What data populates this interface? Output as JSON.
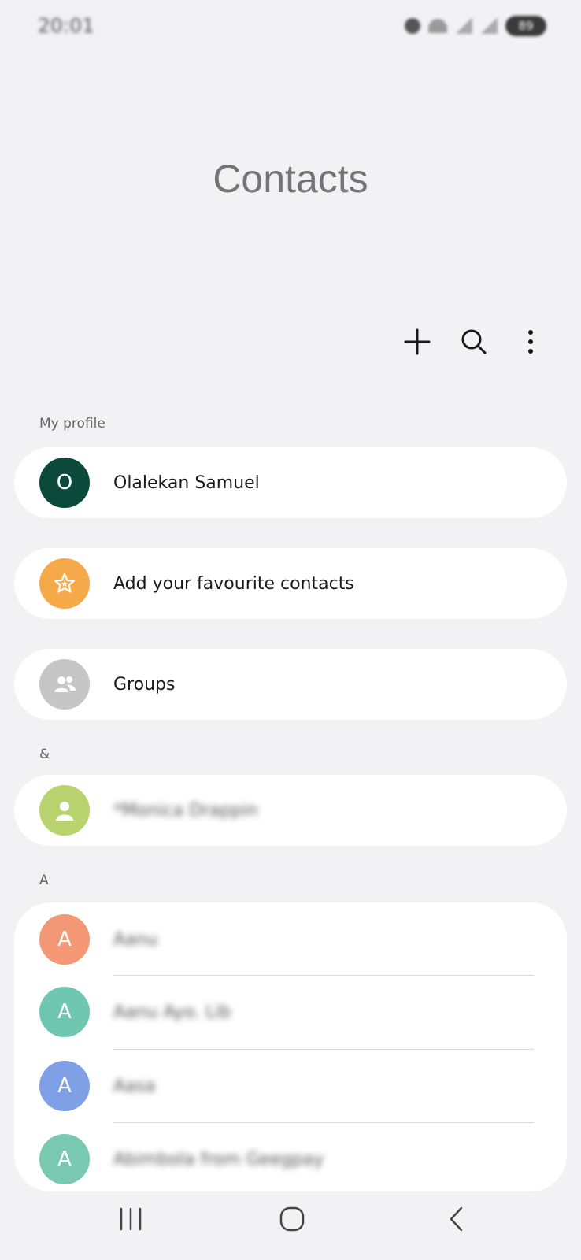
{
  "status_bar": {
    "time": "20:01",
    "battery": "89"
  },
  "header": {
    "title": "Contacts"
  },
  "toolbar": {
    "add_icon": "plus-icon",
    "search_icon": "search-icon",
    "menu_icon": "more-vert-icon"
  },
  "my_profile": {
    "label": "My profile",
    "name": "Olalekan Samuel",
    "initial": "O",
    "avatar_color": "#0b4a3b"
  },
  "favourites": {
    "label": "Add your favourite contacts",
    "icon": "star-icon",
    "avatar_color": "#f5a949"
  },
  "groups": {
    "label": "Groups",
    "icon": "people-icon",
    "avatar_color": "#c6c6c6"
  },
  "section_amp": {
    "label": "&",
    "contact": {
      "name": "*Monica Drappin",
      "avatar_color": "#b9d36f"
    }
  },
  "section_a": {
    "label": "A",
    "contacts": [
      {
        "initial": "A",
        "name": "Aanu",
        "avatar_color": "#f39774"
      },
      {
        "initial": "A",
        "name": "Aanu Ayo. Lib",
        "avatar_color": "#6fc7b1"
      },
      {
        "initial": "A",
        "name": "Aasa",
        "avatar_color": "#7f9fe6"
      },
      {
        "initial": "A",
        "name": "Abimbola from Geegpay",
        "avatar_color": "#78c9b0"
      }
    ]
  },
  "navbar": {
    "recents_icon": "recent-apps-icon",
    "home_icon": "home-icon",
    "back_icon": "back-icon"
  }
}
